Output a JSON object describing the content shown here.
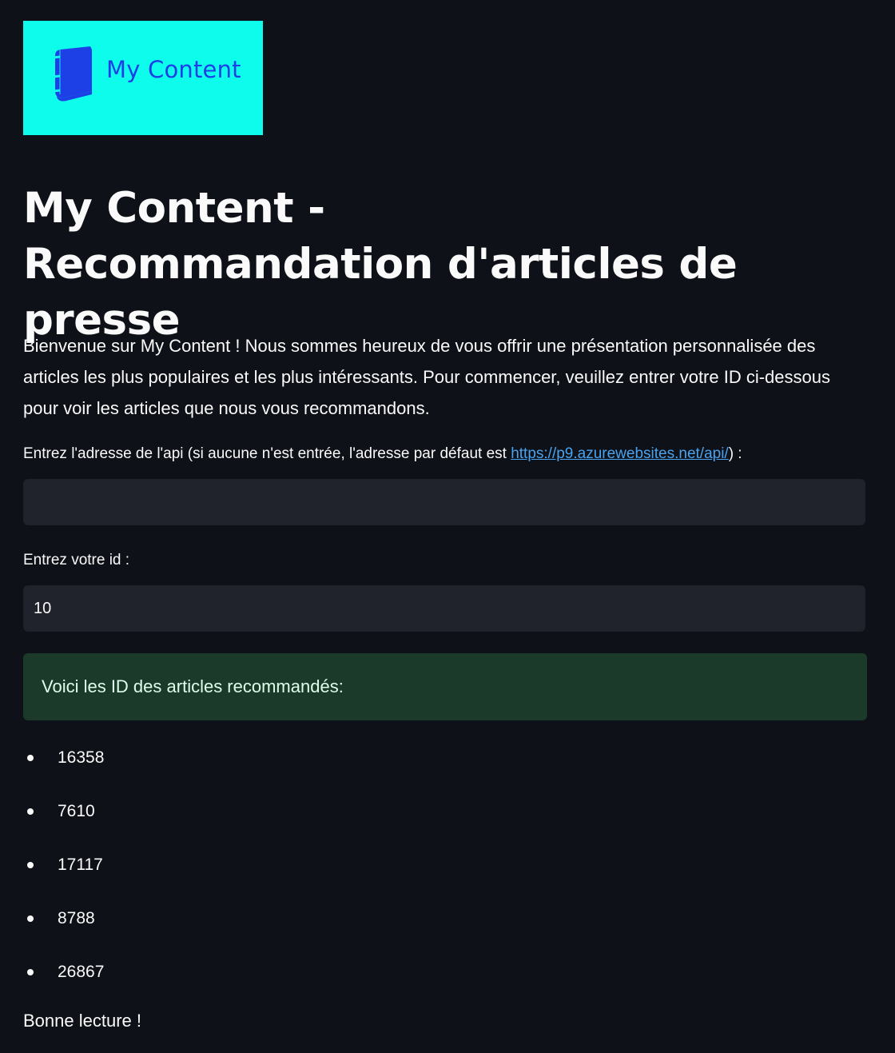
{
  "logo": {
    "text": "My Content",
    "background_color": "#0efcec",
    "text_color": "#1c3fe6",
    "icon": "book-icon"
  },
  "title": "My Content - Recommandation d'articles de presse",
  "intro": "Bienvenue sur My Content ! Nous sommes heureux de vous offrir une présentation personnalisée des articles les plus populaires et les plus intéressants. Pour commencer, veuillez entrer votre ID ci-dessous pour voir les articles que nous vous recommandons.",
  "api_field": {
    "label_prefix": "Entrez l'adresse de l'api (si aucune n'est entrée, l'adresse par défaut est ",
    "link_text": "https://p9.azurewebsites.net/api/",
    "label_suffix": ") :",
    "value": ""
  },
  "id_field": {
    "label": "Entrez votre id :",
    "value": "10"
  },
  "success_message": "Voici les ID des articles recommandés:",
  "recommended_ids": [
    "16358",
    "7610",
    "17117",
    "8788",
    "26867"
  ],
  "closing": "Bonne lecture !",
  "colors": {
    "background": "#0e1117",
    "text": "#fafafa",
    "input_bg": "#21232c",
    "success_bg": "#1b3a2a",
    "success_text": "#dffde9",
    "link": "#4aa3f0"
  }
}
